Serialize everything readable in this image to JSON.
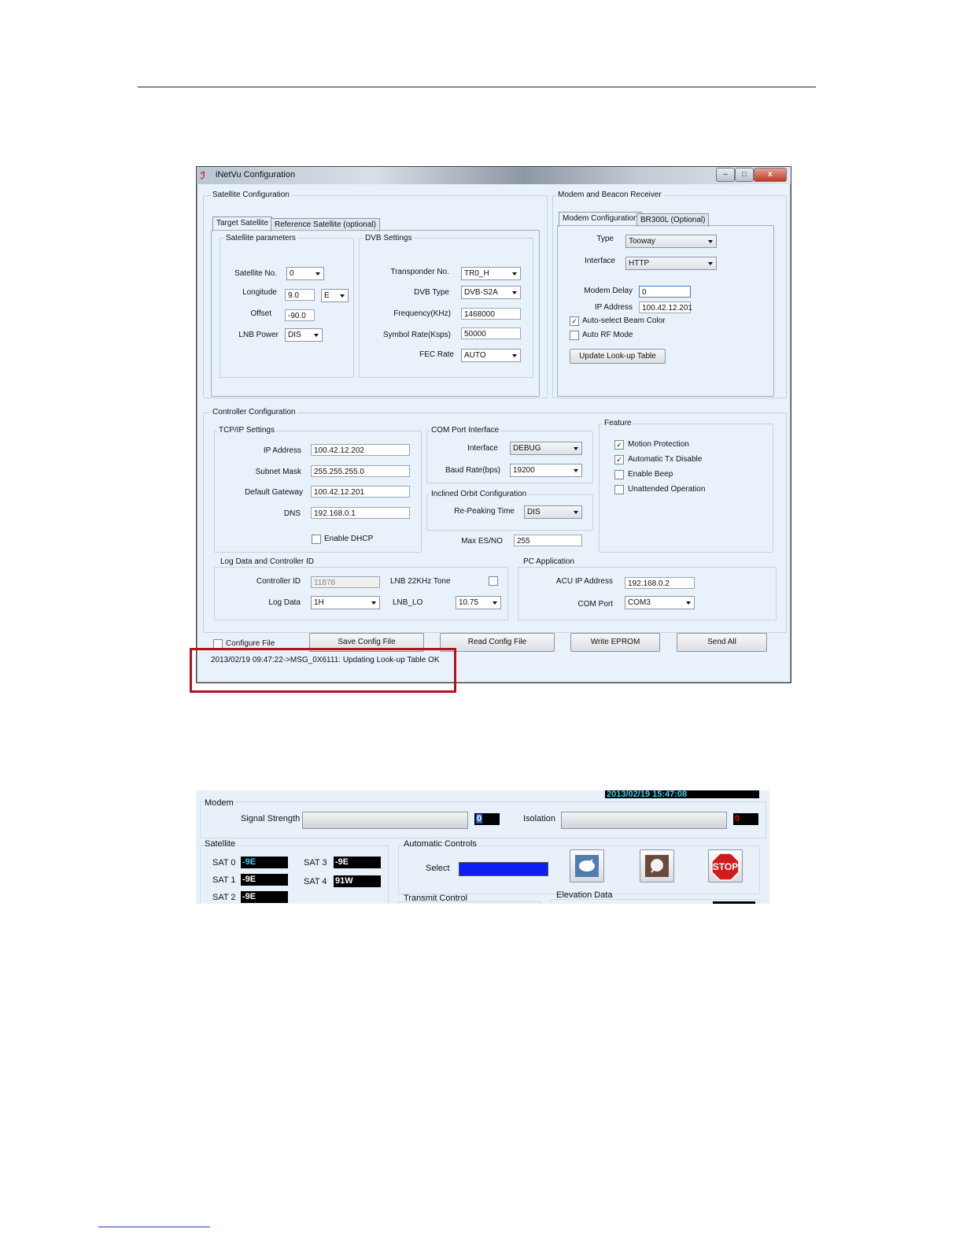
{
  "window": {
    "title": "iNetVu Configuration",
    "controls": [
      "–",
      "□",
      "x"
    ]
  },
  "satellite_config": {
    "title": "Satellite Configuration",
    "tabs": [
      "Target Satellite",
      "Reference Satellite (optional)"
    ],
    "sat_params": {
      "title": "Satellite parameters",
      "satellite_no_label": "Satellite No.",
      "satellite_no": "0",
      "longitude_label": "Longitude",
      "longitude": "9.0",
      "longitude_dir": "E",
      "offset_label": "Offset",
      "offset": "-90.0",
      "lnb_power_label": "LNB Power",
      "lnb_power": "DIS"
    },
    "dvb": {
      "title": "DVB Settings",
      "transponder_label": "Transponder No.",
      "transponder": "TR0_H",
      "dvb_type_label": "DVB Type",
      "dvb_type": "DVB-S2A",
      "frequency_label": "Frequency(KHz)",
      "frequency": "1468000",
      "symbol_rate_label": "Symbol Rate(Ksps)",
      "symbol_rate": "50000",
      "fec_label": "FEC Rate",
      "fec": "AUTO"
    }
  },
  "modem_beacon": {
    "title": "Modem and Beacon Receiver",
    "tabs": [
      "Modem Configuration",
      "BR300L (Optional)"
    ],
    "type_label": "Type",
    "type": "Tooway",
    "interface_label": "Interface",
    "interface": "HTTP",
    "modem_delay_label": "Modem Delay",
    "modem_delay": "0",
    "ip_label": "IP Address",
    "ip": "100.42.12.201",
    "auto_beam_label": "Auto-select Beam Color",
    "auto_beam_checked": true,
    "auto_rf_label": "Auto RF Mode",
    "auto_rf_checked": false,
    "update_button": "Update Look-up Table"
  },
  "controller_config": {
    "title": "Controller Configuration",
    "tcpip": {
      "title": "TCP/IP Settings",
      "ip_label": "IP Address",
      "ip": "100.42.12.202",
      "subnet_label": "Subnet Mask",
      "subnet": "255.255.255.0",
      "gateway_label": "Default Gateway",
      "gateway": "100.42.12.201",
      "dns_label": "DNS",
      "dns": "192.168.0.1",
      "dhcp_label": "Enable DHCP"
    },
    "com_port": {
      "title": "COM Port Interface",
      "interface_label": "Interface",
      "interface": "DEBUG",
      "baud_label": "Baud Rate(bps)",
      "baud": "19200"
    },
    "inclined": {
      "title": "Inclined Orbit Configuration",
      "repeak_label": "Re-Peaking Time",
      "repeak": "DIS"
    },
    "max_esno_label": "Max ES/NO",
    "max_esno": "255",
    "feature": {
      "title": "Feature",
      "items": [
        {
          "label": "Motion Protection",
          "checked": "✓"
        },
        {
          "label": "Automatic Tx Disable",
          "checked": "✓"
        },
        {
          "label": "Enable Beep",
          "checked": ""
        },
        {
          "label": "Unattended Operation",
          "checked": ""
        }
      ]
    },
    "log": {
      "title": "Log Data and Controller ID",
      "controller_id_label": "Controller ID",
      "controller_id": "11878",
      "lnb_tone_label": "LNB 22KHz Tone",
      "log_data_label": "Log Data",
      "log_data": "1H",
      "lnb_lo_label": "LNB_LO",
      "lnb_lo": "10.75"
    },
    "pc_app": {
      "title": "PC Application",
      "acu_ip_label": "ACU IP Address",
      "acu_ip": "192.168.0.2",
      "com_port_label": "COM Port",
      "com_port": "COM3"
    }
  },
  "bottom": {
    "configure_file_label": "Configure File",
    "buttons": [
      "Save Config File",
      "Read Config File",
      "Write EPROM",
      "Send All"
    ],
    "status_message": "2013/02/19 09:47:22->MSG_0X6111: Updating Look-up Table OK"
  },
  "panel2": {
    "datetime": "2013/02/19 15:47:08",
    "modem_title": "Modem",
    "signal_strength_label": "Signal Strength",
    "signal_strength": "0",
    "isolation_label": "Isolation",
    "isolation": "0",
    "satellite_title": "Satellite",
    "sats": [
      {
        "label": "SAT 0",
        "value": "-9E"
      },
      {
        "label": "SAT 1",
        "value": "-9E"
      },
      {
        "label": "SAT 2",
        "value": "-9E"
      },
      {
        "label": "SAT 3",
        "value": "-9E"
      },
      {
        "label": "SAT 4",
        "value": "91W"
      }
    ],
    "auto_controls_title": "Automatic Controls",
    "select_label": "Select",
    "stop_label": "STOP",
    "transmit_control_title": "Transmit Control",
    "elevation_data_title": "Elevation Data",
    "colors": {
      "select_bar": "#0a1ff0",
      "cyan_text": "#2fd6f0",
      "red_text": "#e01010",
      "stop_red": "#d01c1c"
    }
  }
}
